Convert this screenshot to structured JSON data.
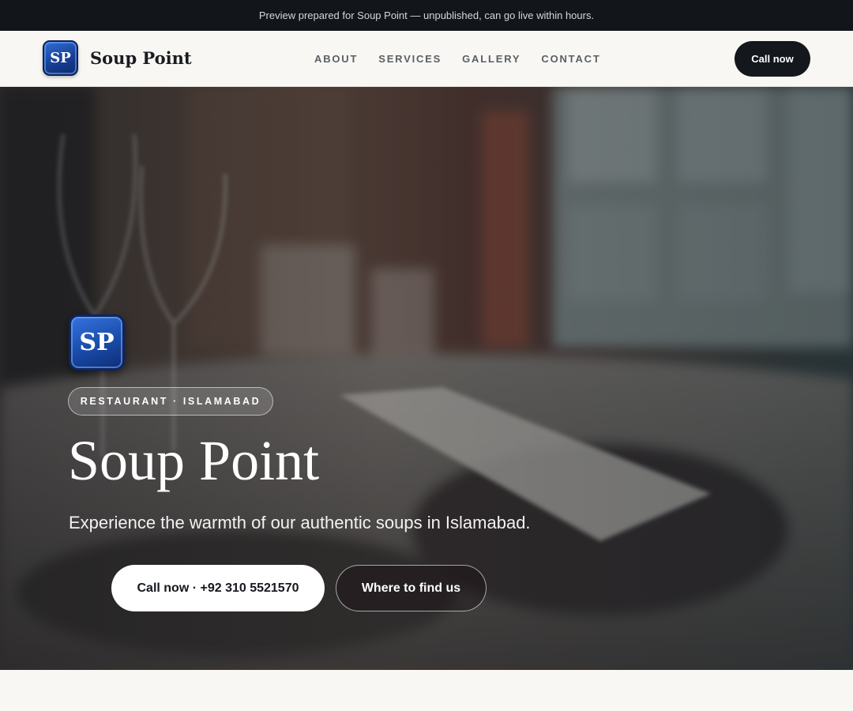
{
  "announcement": "Preview prepared for Soup Point — unpublished, can go live within hours.",
  "header": {
    "logo_initials": "SP",
    "brand_name": "Soup Point",
    "nav": [
      "ABOUT",
      "SERVICES",
      "GALLERY",
      "CONTACT"
    ],
    "cta_label": "Call now"
  },
  "hero": {
    "logo_initials": "SP",
    "badge": "RESTAURANT · ISLAMABAD",
    "title": "Soup Point",
    "subtitle": "Experience the warmth of our authentic soups in Islamabad.",
    "primary_button": "Call now · +92 310 5521570",
    "secondary_button": "Where to find us",
    "background_image": "blurred restaurant table with wine glasses and menu"
  },
  "colors": {
    "topbar": "#12151a",
    "page_bg": "#f8f7f4",
    "dark_button": "#14171c",
    "logo_blue": "#1a4ba8"
  }
}
